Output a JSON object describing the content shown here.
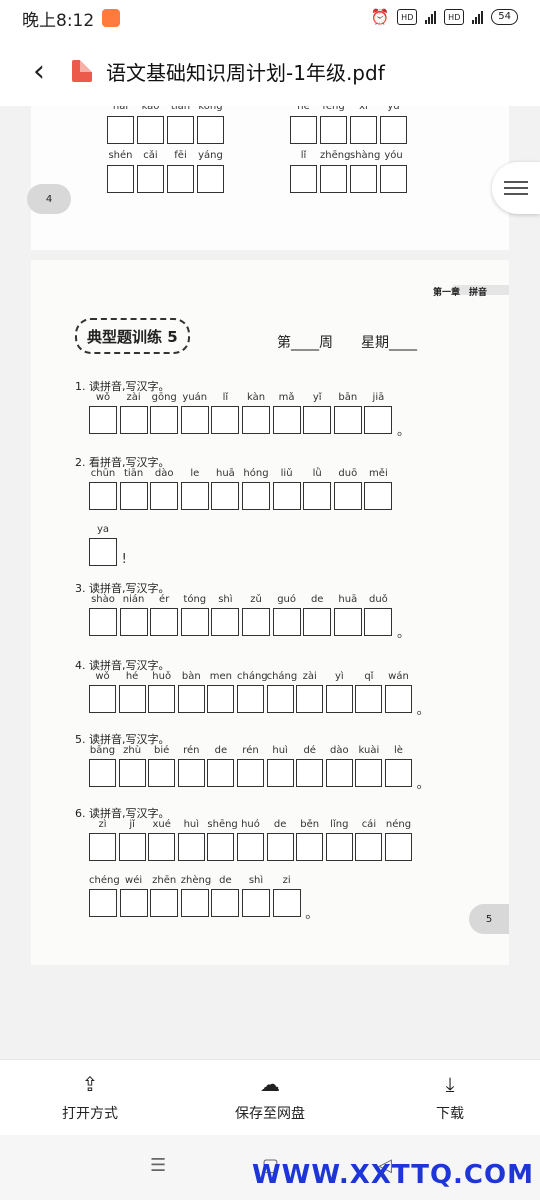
{
  "status": {
    "time": "晚上8:12",
    "battery": "54"
  },
  "header": {
    "title": "语文基础知识周计划-1年级.pdf",
    "back": "‹"
  },
  "page4": {
    "top_pinyin_left": [
      "hai",
      "kao",
      "tian",
      "kong"
    ],
    "top_pinyin_right": [
      "he",
      "feng",
      "xi",
      "yu"
    ],
    "pinyin_left": [
      "shén",
      "cǎi",
      "fēi",
      "yáng"
    ],
    "pinyin_right": [
      "lǐ",
      "zhēng",
      "shàng",
      "yóu"
    ],
    "page_number": "4"
  },
  "page5": {
    "chapter": "第一章　拼音",
    "exercise_title": "典型题训练 5",
    "week_text": "第____周　　星期____",
    "page_number": "5",
    "questions": [
      {
        "label": "1. 读拼音,写汉字。",
        "rows": [
          {
            "pinyin": [
              "wǒ",
              "zài",
              "gōng",
              "yuán",
              "lǐ",
              "kàn",
              "mǎ",
              "yǐ",
              "bān",
              "jiā"
            ],
            "end": "。"
          }
        ]
      },
      {
        "label": "2. 看拼音,写汉字。",
        "rows": [
          {
            "pinyin": [
              "chūn",
              "tiān",
              "dào",
              "le",
              "huā",
              "hóng",
              "liǔ",
              "lǜ",
              "duō",
              "měi"
            ],
            "end": ""
          },
          {
            "pinyin": [
              "ya"
            ],
            "end": "!"
          }
        ]
      },
      {
        "label": "3. 读拼音,写汉字。",
        "rows": [
          {
            "pinyin": [
              "shào",
              "nián",
              "ér",
              "tóng",
              "shì",
              "zǔ",
              "guó",
              "de",
              "huā",
              "duǒ"
            ],
            "end": "。"
          }
        ]
      },
      {
        "label": "4. 读拼音,写汉字。",
        "rows": [
          {
            "pinyin": [
              "wǒ",
              "hé",
              "huǒ",
              "bàn",
              "men",
              "cháng",
              "cháng",
              "zài",
              "yì",
              "qǐ",
              "wán"
            ],
            "end": "。"
          }
        ]
      },
      {
        "label": "5. 读拼音,写汉字。",
        "rows": [
          {
            "pinyin": [
              "bāng",
              "zhù",
              "bié",
              "rén",
              "de",
              "rén",
              "huì",
              "dé",
              "dào",
              "kuài",
              "lè"
            ],
            "end": "。"
          }
        ]
      },
      {
        "label": "6. 读拼音,写汉字。",
        "rows": [
          {
            "pinyin": [
              "zì",
              "jǐ",
              "xué",
              "huì",
              "shēng",
              "huó",
              "de",
              "běn",
              "lǐng",
              "cái",
              "néng"
            ],
            "end": ""
          },
          {
            "pinyin": [
              "chéng",
              "wéi",
              "zhēn",
              "zhèng",
              "de",
              "shì",
              "zi"
            ],
            "end": "。"
          }
        ]
      }
    ]
  },
  "toolbar": {
    "open_with": "打开方式",
    "save_to_disk": "保存至网盘",
    "download": "下载"
  },
  "watermark": "WWW.XXTTQ.COM"
}
